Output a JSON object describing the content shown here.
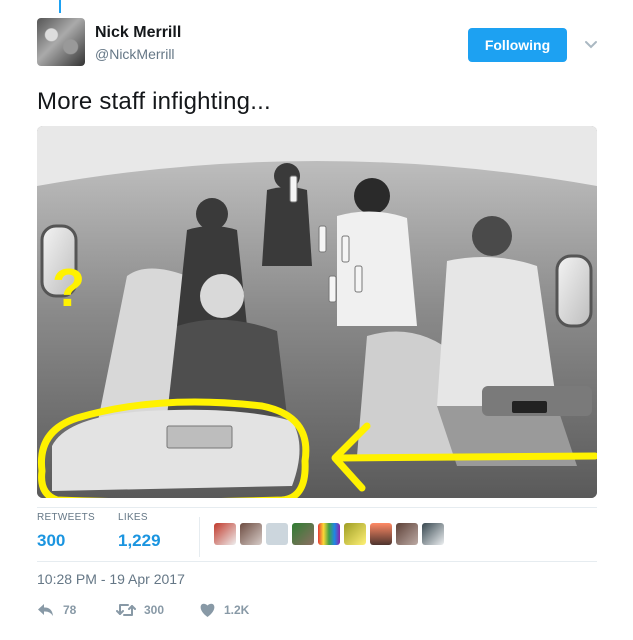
{
  "user": {
    "name": "Nick Merrill",
    "handle": "@NickMerrill",
    "follow_label": "Following"
  },
  "tweet": {
    "text": "More staff infighting...",
    "image_annotation": "?",
    "timestamp": "10:28 PM - 19 Apr 2017"
  },
  "stats": {
    "retweets_label": "RETWEETS",
    "retweets": "300",
    "likes_label": "LIKES",
    "likes": "1,229"
  },
  "actions": {
    "replies": "78",
    "retweets": "300",
    "likes": "1.2K"
  },
  "colors": {
    "accent": "#1da1f2",
    "link": "#1b95e0",
    "muted": "#657786",
    "annotation": "#fff200"
  },
  "icons": {
    "reply": "reply-icon",
    "retweet": "retweet-icon",
    "like": "heart-icon",
    "caret": "chevron-down-icon"
  }
}
